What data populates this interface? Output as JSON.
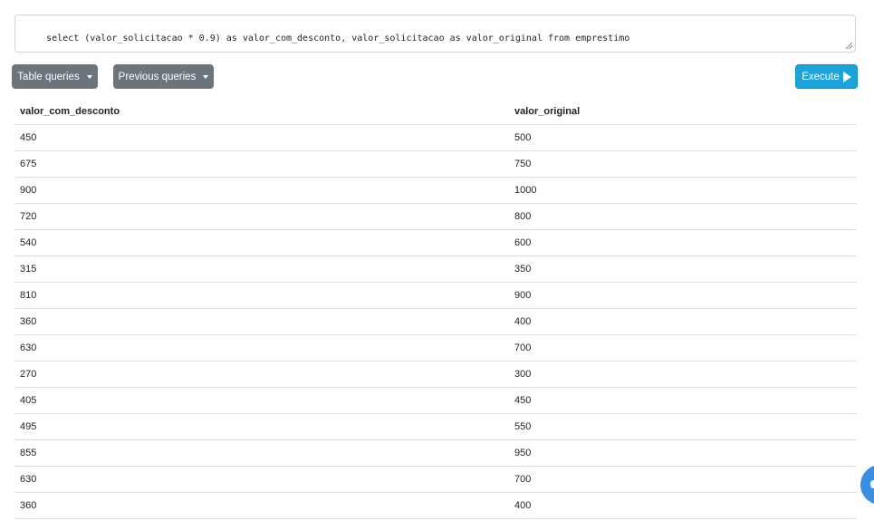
{
  "query": {
    "text": "select (valor_solicitacao * 0.9) as valor_com_desconto, valor_solicitacao as valor_original from emprestimo"
  },
  "toolbar": {
    "table_queries_label": "Table queries",
    "previous_queries_label": "Previous queries",
    "execute_label": "Execute"
  },
  "icons": {
    "dropdown": "chevron-down-icon",
    "execute": "play-icon",
    "chat": "chat-bubble-icon"
  },
  "colors": {
    "secondary_button": "#6c757d",
    "execute_button": "#1ba3db",
    "fab": "#3b8fe0"
  },
  "results": {
    "columns": [
      "valor_com_desconto",
      "valor_original"
    ],
    "rows": [
      [
        "450",
        "500"
      ],
      [
        "675",
        "750"
      ],
      [
        "900",
        "1000"
      ],
      [
        "720",
        "800"
      ],
      [
        "540",
        "600"
      ],
      [
        "315",
        "350"
      ],
      [
        "810",
        "900"
      ],
      [
        "360",
        "400"
      ],
      [
        "630",
        "700"
      ],
      [
        "270",
        "300"
      ],
      [
        "405",
        "450"
      ],
      [
        "495",
        "550"
      ],
      [
        "855",
        "950"
      ],
      [
        "630",
        "700"
      ],
      [
        "360",
        "400"
      ]
    ]
  }
}
